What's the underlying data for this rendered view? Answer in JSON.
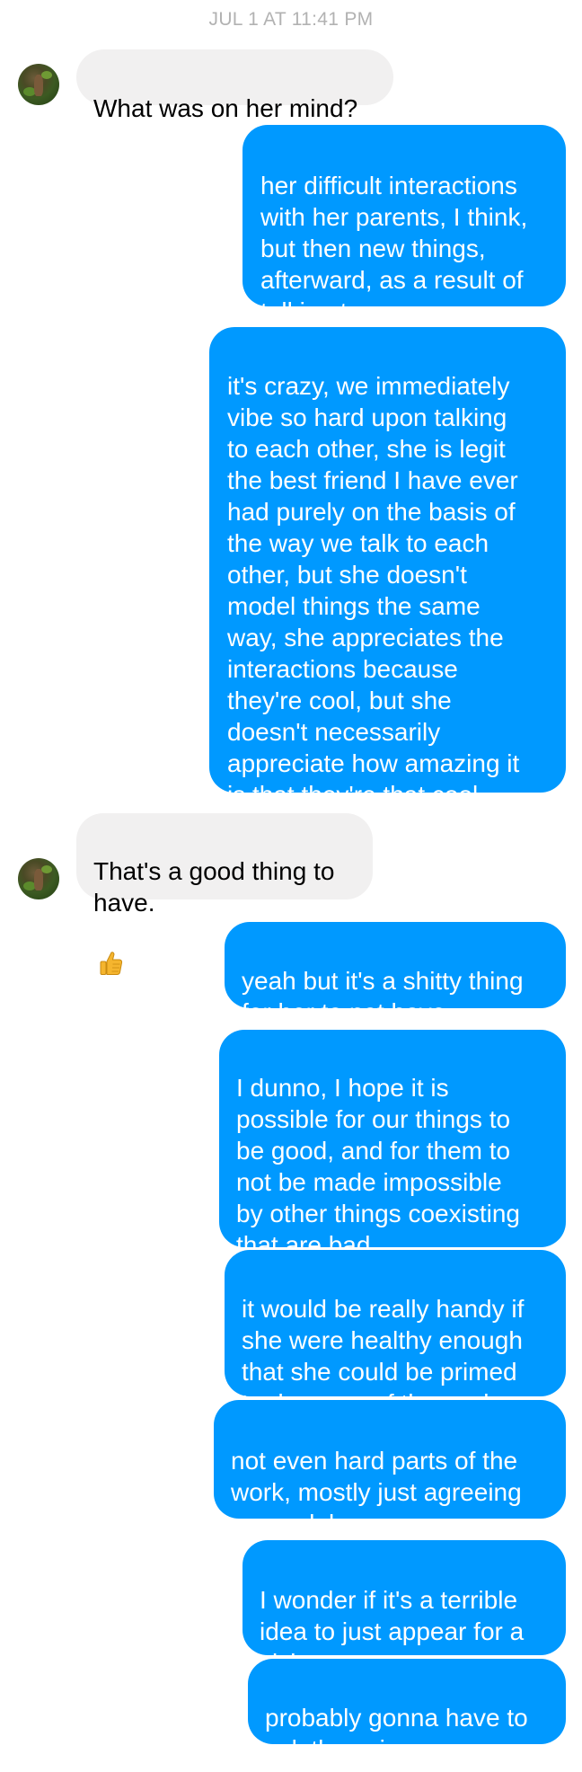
{
  "conversation": {
    "timestamp": "JUL 1 AT 11:41 PM",
    "messages": [
      {
        "sender": "them",
        "text": "What was on her mind?"
      },
      {
        "sender": "me",
        "text": "her difficult interactions\nwith her parents, I think,\nbut then new things,\nafterward, as a result of\ntalking to me"
      },
      {
        "sender": "me",
        "text": "it's crazy, we immediately\nvibe so hard upon talking\nto each other, she is legit\nthe best friend I have ever\nhad purely on the basis of\nthe way we talk to each\nother, but she doesn't\nmodel things the same\nway, she appreciates the\ninteractions because\nthey're cool, but she\ndoesn't necessarily\nappreciate how amazing it\nis that they're that cool"
      },
      {
        "sender": "them",
        "text": "That's a good thing to\nhave.",
        "emoji": "thumbs-up-icon"
      },
      {
        "sender": "me",
        "text": "yeah but it's a shitty thing\nfor her to not have"
      },
      {
        "sender": "me",
        "text": "I dunno, I hope it is\npossible for our things to\nbe good, and for them to\nnot be made impossible\nby other things coexisting\nthat are bad"
      },
      {
        "sender": "me",
        "text": "it would be really handy if\nshe were healthy enough\nthat she could be primed\nto do some of the work"
      },
      {
        "sender": "me",
        "text": "not even hard parts of the\nwork, mostly just agreeing\non models"
      },
      {
        "sender": "me",
        "text": "I wonder if it's a terrible\nidea to just appear for a\nvisit"
      },
      {
        "sender": "me",
        "text": "probably gonna have to\nask the coin"
      }
    ]
  },
  "colors": {
    "outgoing_bubble": "#0099ff",
    "incoming_bubble": "#f1f0f0",
    "timestamp_text": "#b2b2b2",
    "emoji": "#f5b52e"
  }
}
